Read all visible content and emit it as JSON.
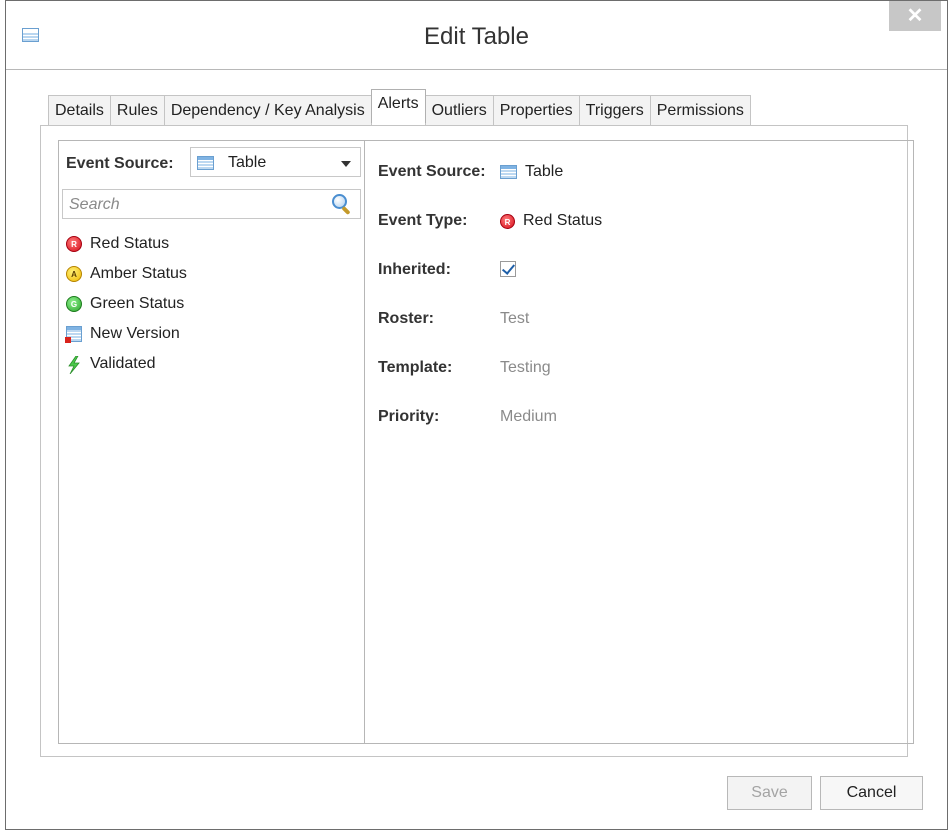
{
  "window": {
    "title": "Edit Table",
    "close_glyph": "✕",
    "icon": "table-icon"
  },
  "tabs": [
    {
      "label": "Details",
      "active": false
    },
    {
      "label": "Rules",
      "active": false
    },
    {
      "label": "Dependency / Key Analysis",
      "active": false
    },
    {
      "label": "Alerts",
      "active": true
    },
    {
      "label": "Outliers",
      "active": false
    },
    {
      "label": "Properties",
      "active": false
    },
    {
      "label": "Triggers",
      "active": false
    },
    {
      "label": "Permissions",
      "active": false
    }
  ],
  "left_panel": {
    "event_source_label": "Event Source:",
    "event_source_value": "Table",
    "event_source_icon": "table-icon",
    "search_placeholder": "Search",
    "search_icon": "magnifier-icon",
    "events": [
      {
        "label": "Red Status",
        "icon": "red-status-icon",
        "badge": "R"
      },
      {
        "label": "Amber Status",
        "icon": "amber-status-icon",
        "badge": "A"
      },
      {
        "label": "Green Status",
        "icon": "green-status-icon",
        "badge": "G"
      },
      {
        "label": "New Version",
        "icon": "new-version-icon"
      },
      {
        "label": "Validated",
        "icon": "lightning-icon"
      }
    ]
  },
  "details": {
    "event_source": {
      "label": "Event Source:",
      "value": "Table",
      "icon": "table-icon"
    },
    "event_type": {
      "label": "Event Type:",
      "value": "Red Status",
      "icon": "red-status-icon",
      "badge": "R"
    },
    "inherited": {
      "label": "Inherited:",
      "checked": true
    },
    "roster": {
      "label": "Roster:",
      "value": "Test"
    },
    "template": {
      "label": "Template:",
      "value": "Testing"
    },
    "priority": {
      "label": "Priority:",
      "value": "Medium"
    }
  },
  "buttons": {
    "save": "Save",
    "cancel": "Cancel"
  },
  "colors": {
    "red_status": "#d60d1a",
    "amber_status": "#f0b800",
    "green_status": "#2ca62c",
    "accent": "#4a8ed0"
  }
}
